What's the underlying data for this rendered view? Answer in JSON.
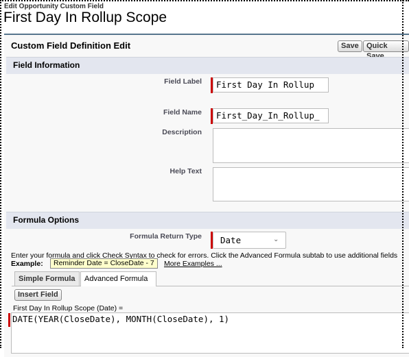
{
  "header": {
    "eyebrow": "Edit Opportunity Custom Field",
    "title": "First Day In Rollup Scope"
  },
  "panel": {
    "title": "Custom Field Definition Edit",
    "save_label": "Save",
    "quick_save_label": "Quick Save"
  },
  "field_info": {
    "section_title": "Field Information",
    "field_label_label": "Field Label",
    "field_label_value": "First Day In Rollup",
    "field_name_label": "Field Name",
    "field_name_value": "First_Day_In_Rollup_",
    "description_label": "Description",
    "help_text_label": "Help Text"
  },
  "formula_options": {
    "section_title": "Formula Options",
    "return_type_label": "Formula Return Type",
    "return_type_value": "Date",
    "info_text": "Enter your formula and click Check Syntax to check for errors. Click the Advanced Formula subtab to use additional fields",
    "example_label": "Example:",
    "example_value": "Reminder Date = CloseDate - 7",
    "more_examples": "More Examples ...",
    "tabs": [
      "Simple Formula",
      "Advanced Formula"
    ],
    "active_tab": "Advanced Formula",
    "insert_field_label": "Insert Field",
    "formula_caption": "First Day In Rollup Scope (Date) =",
    "formula_value": "DATE(YEAR(CloseDate), MONTH(CloseDate), 1)"
  },
  "colors": {
    "required_marker": "#cc0000",
    "section_bar": "#e3e6ef",
    "panel_top_border": "#56758c"
  }
}
